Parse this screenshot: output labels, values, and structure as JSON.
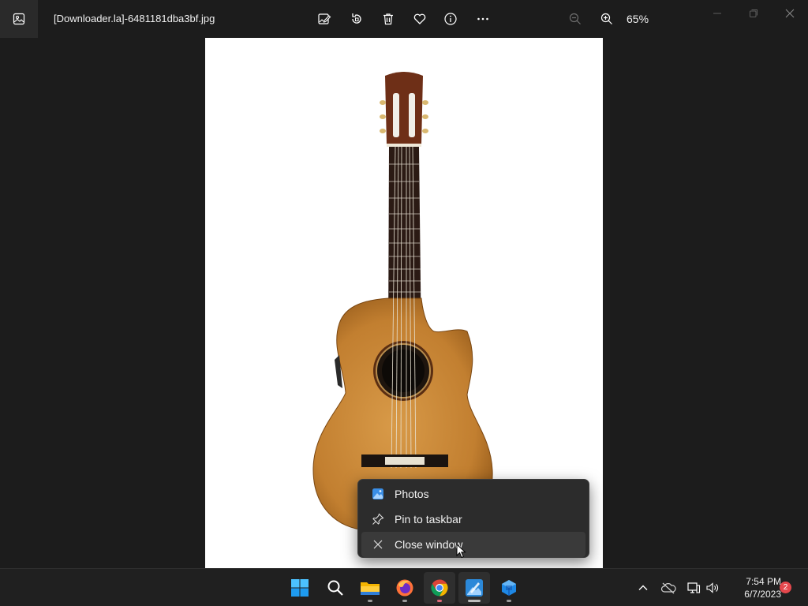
{
  "window": {
    "title": "[Downloader.la]-6481181dba3bf.jpg",
    "zoom": "65%"
  },
  "toolbar": {
    "icons": [
      "edit-image-icon",
      "rotate-icon",
      "delete-icon",
      "favorite-icon",
      "info-icon",
      "more-icon",
      "zoom-out-icon",
      "zoom-in-icon"
    ]
  },
  "context_menu": {
    "items": [
      {
        "label": "Photos",
        "icon": "photos-app-icon"
      },
      {
        "label": "Pin to taskbar",
        "icon": "pin-icon"
      },
      {
        "label": "Close window",
        "icon": "close-icon"
      }
    ]
  },
  "taskbar": {
    "apps": [
      "start-icon",
      "search-icon",
      "file-explorer-icon",
      "firefox-icon",
      "chrome-icon",
      "photos-icon",
      "python-box-icon"
    ],
    "time": "7:54 PM",
    "date": "6/7/2023",
    "notifications": "2"
  },
  "colors": {
    "accent": "#0078d4",
    "window_bg": "#1c1c1c",
    "menu_bg": "#2c2c2c"
  }
}
